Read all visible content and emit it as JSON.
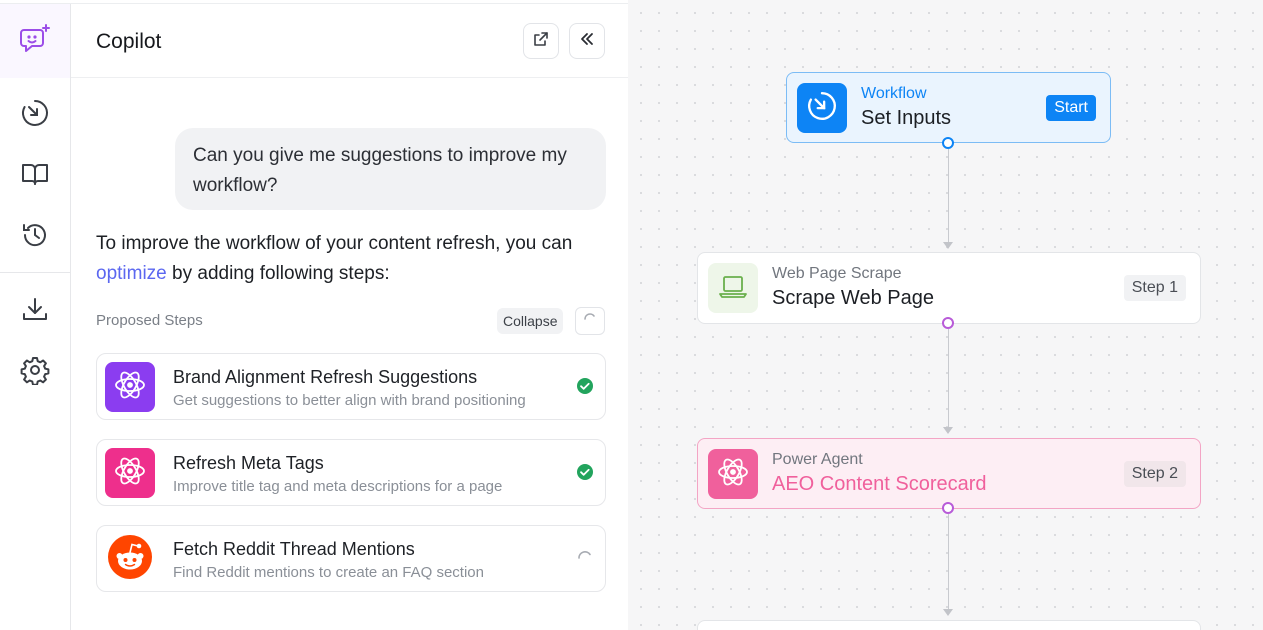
{
  "panel": {
    "title": "Copilot"
  },
  "chat": {
    "user_message": "Can you give me suggestions to improve my workflow?",
    "answer_prefix": "To improve the workflow of your content refresh, you can ",
    "answer_link": "optimize",
    "answer_suffix": " by adding following steps:"
  },
  "proposed": {
    "label": "Proposed Steps",
    "collapse_label": "Collapse",
    "steps": [
      {
        "title": "Brand Alignment Refresh Suggestions",
        "desc": "Get suggestions to better align with brand positioning",
        "status": "done",
        "icon": "atom-icon",
        "color": "#8b3df0"
      },
      {
        "title": "Refresh Meta Tags",
        "desc": "Improve title tag and meta descriptions for a page",
        "status": "done",
        "icon": "atom-icon",
        "color": "#ee2f8c"
      },
      {
        "title": "Fetch Reddit Thread Mentions",
        "desc": "Find Reddit mentions to create an FAQ section",
        "status": "loading",
        "icon": "reddit-icon",
        "color": "#ff4500"
      }
    ]
  },
  "workflow": {
    "nodes": [
      {
        "subtitle": "Workflow",
        "title": "Set Inputs",
        "badge": "Start"
      },
      {
        "subtitle": "Web Page Scrape",
        "title": "Scrape Web Page",
        "badge": "Step 1"
      },
      {
        "subtitle": "Power Agent",
        "title": "AEO Content Scorecard",
        "badge": "Step 2"
      }
    ]
  },
  "colors": {
    "accent_blue": "#0d84f5",
    "accent_pink": "#f0609c",
    "accent_purple": "#8b3df0",
    "success_green": "#22a45d"
  }
}
